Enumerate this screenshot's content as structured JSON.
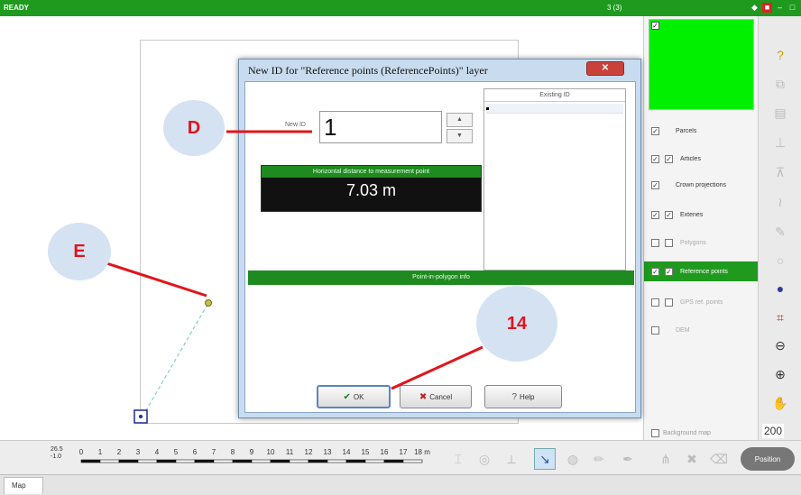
{
  "status_bar": {
    "status": "READY",
    "selection_count": "3 (3)"
  },
  "dialog": {
    "title": "New ID for \"Reference points (ReferencePoints)\" layer",
    "new_id_label": "New ID",
    "new_id_value": "1",
    "existing_id_header": "Existing ID",
    "distance_title": "Horizontal distance to measurement point",
    "distance_value": "7.03 m",
    "point_in_polygon_title": "Point-in-polygon info",
    "buttons": {
      "ok": "OK",
      "cancel": "Cancel",
      "help": "Help"
    }
  },
  "layers": [
    {
      "label": "Parcels",
      "checked": true,
      "active": false
    },
    {
      "label": "Articles",
      "checked": true,
      "active": false
    },
    {
      "label": "Crown projections",
      "checked": true,
      "active": false
    },
    {
      "label": "Extenes",
      "checked": true,
      "active": false
    },
    {
      "label": "Polygons",
      "checked": false,
      "active": false
    },
    {
      "label": "Reference points",
      "checked": true,
      "active": true
    },
    {
      "label": "GPS ref. points",
      "checked": false,
      "active": false
    },
    {
      "label": "DEM",
      "checked": false,
      "active": false
    }
  ],
  "layer_panel": {
    "background_map": "Background map"
  },
  "tool_column": {
    "zoom_label": "200"
  },
  "scale": {
    "top": "26.5",
    "bottom": "-1.0",
    "ticks": [
      "0",
      "1",
      "2",
      "3",
      "4",
      "5",
      "6",
      "7",
      "8",
      "9",
      "10",
      "11",
      "12",
      "13",
      "14",
      "15",
      "16",
      "17"
    ],
    "unit_label": "18 m"
  },
  "bottom_toolbar": {
    "position_label": "Position"
  },
  "tabs": {
    "map": "Map"
  },
  "annotations": {
    "d": "D",
    "e": "E",
    "n14": "14"
  },
  "colors": {
    "accent_green": "#1f9a1f",
    "annotation_red": "#e2141b",
    "bubble_blue": "#d4e2f2"
  }
}
